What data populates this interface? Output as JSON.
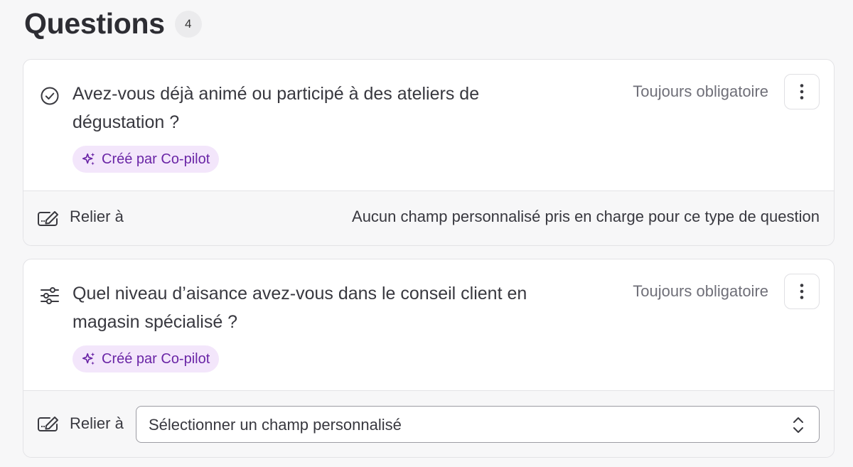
{
  "header": {
    "title": "Questions",
    "count": "4"
  },
  "questions": [
    {
      "icon": "check-circle-icon",
      "text": "Avez-vous déjà animé ou participé à des ateliers de dégustation ?",
      "requirement": "Toujours obligatoire",
      "badge": "Créé par Co-pilot",
      "link_label": "Relier à",
      "link_note": "Aucun champ personnalisé pris en charge pour ce type de question"
    },
    {
      "icon": "sliders-icon",
      "text": "Quel niveau d’aisance avez-vous dans le conseil client en magasin spécialisé ?",
      "requirement": "Toujours obligatoire",
      "badge": "Créé par Co-pilot",
      "link_label": "Relier à",
      "select_placeholder": "Sélectionner un champ personnalisé"
    }
  ],
  "colors": {
    "badge_bg": "#f3e6fb",
    "badge_text": "#6a25a6"
  }
}
